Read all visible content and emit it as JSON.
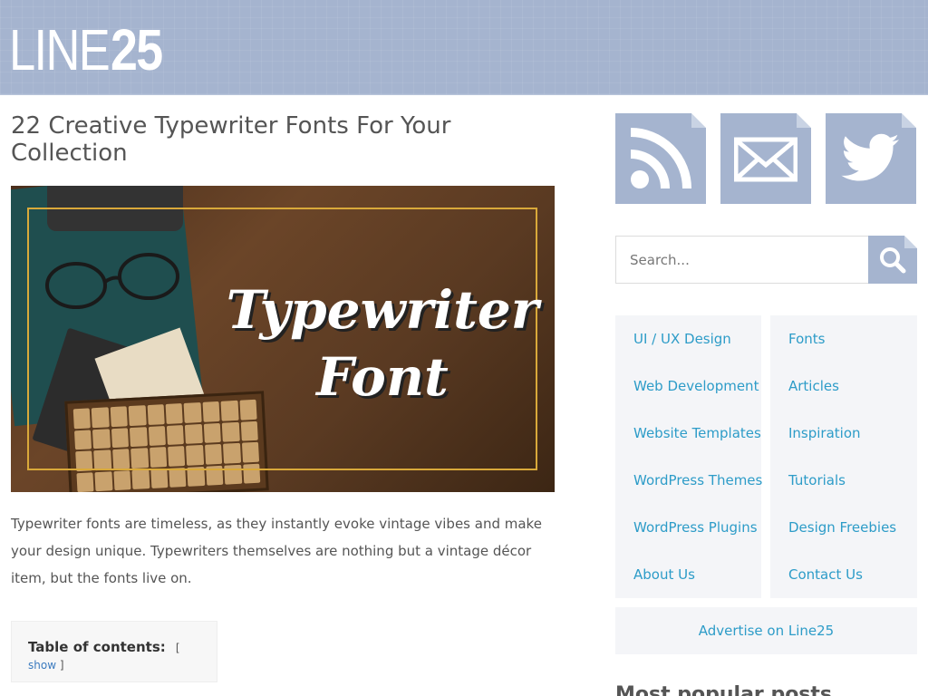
{
  "header": {
    "logo_thin": "LINE",
    "logo_bold": "25",
    "background_color": "#a5b4cf"
  },
  "post": {
    "title": "22 Creative Typewriter Fonts For Your Collection",
    "hero_text_line1": "Typewriter",
    "hero_text_line2": "Font",
    "excerpt": "Typewriter fonts are timeless, as they instantly evoke vintage vibes and make your design unique. Typewriters themselves are nothing but a vintage décor item, but the fonts live on.",
    "toc": {
      "title": "Table of contents:",
      "toggle_open": "[",
      "toggle_label": "show",
      "toggle_close": "]"
    }
  },
  "sidebar": {
    "social": [
      {
        "icon": "rss-icon"
      },
      {
        "icon": "mail-icon"
      },
      {
        "icon": "twitter-icon"
      }
    ],
    "search": {
      "placeholder": "Search...",
      "button_icon": "search-icon"
    },
    "categories_left": [
      "UI / UX Design",
      "Web Development",
      "Website Templates",
      "WordPress Themes",
      "WordPress Plugins",
      "About Us"
    ],
    "categories_right": [
      "Fonts",
      "Articles",
      "Inspiration",
      "Tutorials",
      "Design Freebies",
      "Contact Us"
    ],
    "advertise": "Advertise on Line25",
    "popular_heading": "Most popular posts",
    "link_color": "#2d9cc8"
  }
}
